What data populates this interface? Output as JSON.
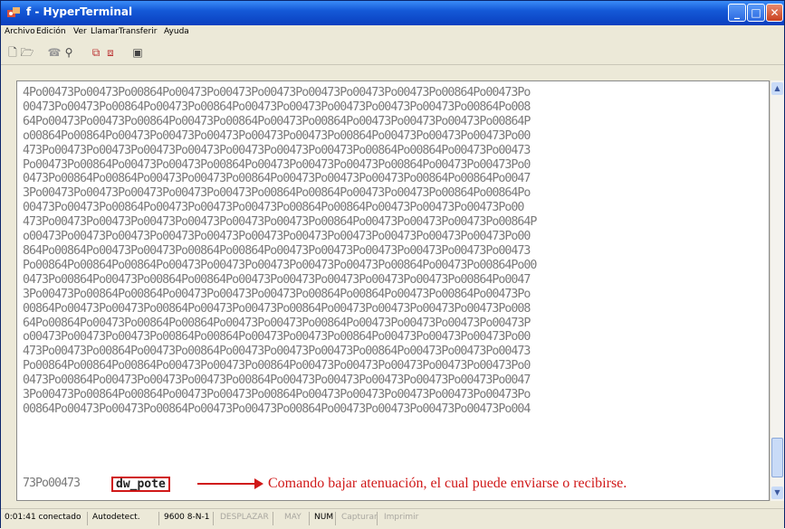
{
  "window": {
    "title": "f - HyperTerminal"
  },
  "menu": [
    "Archivo",
    "Edición",
    "Ver",
    "Llamar",
    "Transferir",
    "Ayuda"
  ],
  "toolbar": {
    "icons": [
      "new-icon",
      "open-icon",
      "call-icon",
      "disconnect-icon",
      "send-icon",
      "receive-icon",
      "properties-icon"
    ]
  },
  "terminal": {
    "lines": [
      "4Po00473Po00473Po00864Po00473Po00473Po00473Po00473Po00473Po00473Po00864Po00473Po",
      "00473Po00473Po00864Po00473Po00864Po00473Po00473Po00473Po00473Po00473Po00864Po008",
      "64Po00473Po00473Po00864Po00473Po00864Po00473Po00864Po00473Po00473Po00473Po00864P",
      "o00864Po00864Po00473Po00473Po00473Po00473Po00473Po00864Po00473Po00473Po00473Po00",
      "473Po00473Po00473Po00473Po00473Po00473Po00473Po00473Po00864Po00864Po00473Po00473",
      "Po00473Po00864Po00473Po00473Po00864Po00473Po00473Po00473Po00864Po00473Po00473Po0",
      "0473Po00864Po00864Po00473Po00473Po00864Po00473Po00473Po00473Po00864Po00864Po0047",
      "3Po00473Po00473Po00473Po00473Po00473Po00864Po00864Po00473Po00473Po00864Po00864Po",
      "00473Po00473Po00864Po00473Po00473Po00473Po00864Po00864Po00473Po00473Po00473Po00",
      "473Po00473Po00473Po00473Po00473Po00473Po00473Po00864Po00473Po00473Po00473Po00864P",
      "o00473Po00473Po00473Po00473Po00473Po00473Po00473Po00473Po00473Po00473Po00473Po00",
      "864Po00864Po00473Po00473Po00864Po00864Po00473Po00473Po00473Po00473Po00473Po00473",
      "Po00864Po00864Po00864Po00473Po00473Po00473Po00473Po00473Po00864Po00473Po00864Po00",
      "0473Po00864Po00473Po00864Po00864Po00473Po00473Po00473Po00473Po00473Po00864Po0047",
      "3Po00473Po00864Po00864Po00473Po00473Po00473Po00864Po00864Po00473Po00864Po00473Po",
      "00864Po00473Po00473Po00864Po00473Po00473Po00864Po00473Po00473Po00473Po00473Po008",
      "64Po00864Po00473Po00864Po00864Po00473Po00473Po00864Po00473Po00473Po00473Po00473P",
      "o00473Po00473Po00473Po00864Po00864Po00473Po00473Po00864Po00473Po00473Po00473Po00",
      "473Po00473Po00864Po00473Po00864Po00473Po00473Po00473Po00864Po00473Po00473Po00473",
      "Po00864Po00864Po00864Po00473Po00473Po00864Po00473Po00473Po00473Po00473Po00473Po0",
      "0473Po00864Po00473Po00473Po00473Po00864Po00473Po00473Po00473Po00473Po00473Po0047",
      "3Po00473Po00864Po00864Po00473Po00473Po00864Po00473Po00473Po00473Po00473Po00473Po",
      "00864Po00473Po00473Po00864Po00473Po00473Po00864Po00473Po00473Po00473Po00473Po004"
    ],
    "last_prefix": "73Po00473",
    "command": "dw_pote",
    "annotation": "Comando bajar atenuación, el cual puede enviarse o recibirse."
  },
  "status": {
    "connected": "0:01:41 conectado",
    "detect": "Autodetect.",
    "params": "9600 8-N-1",
    "scroll": "DESPLAZAR",
    "caps": "MAY",
    "num": "NUM",
    "capture": "Capturar",
    "print": "Imprimir"
  },
  "colors": {
    "annotation": "#d01818",
    "title_bar": "#1459d7"
  }
}
